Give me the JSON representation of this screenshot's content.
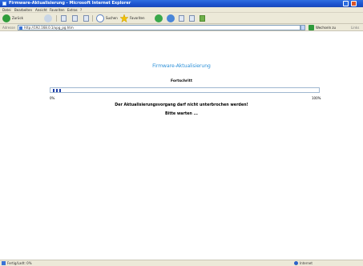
{
  "window": {
    "title": "Firmware-Aktualisierung - Microsoft Internet Explorer"
  },
  "menu": [
    "Datei",
    "Bearbeiten",
    "Ansicht",
    "Favoriten",
    "Extras",
    "?"
  ],
  "toolbar": {
    "back_label": "Zurück",
    "search_label": "Suchen",
    "favorites_label": "Favoriten"
  },
  "address": {
    "label": "Adresse",
    "url": "http://192.168.0.1/upg_pg.htm",
    "go_label": "Wechseln zu",
    "links_label": "Links"
  },
  "page": {
    "title": "Firmware-Aktualisierung",
    "progress_label": "Fortschritt",
    "progress_fraction": 0.04,
    "pct_min": "0%",
    "pct_max": "100%",
    "warning": "Der Aktualisierungsvorgang darf nicht unterbrochen werden!",
    "wait": "Bitte warten ..."
  },
  "status": {
    "text": "Fertig/Ladt: 0%",
    "zone": "Internet"
  },
  "colors": {
    "titlebar": "#1c52cf",
    "page_title": "#2a8fd8",
    "progress_fill": "#1f3fa8"
  }
}
